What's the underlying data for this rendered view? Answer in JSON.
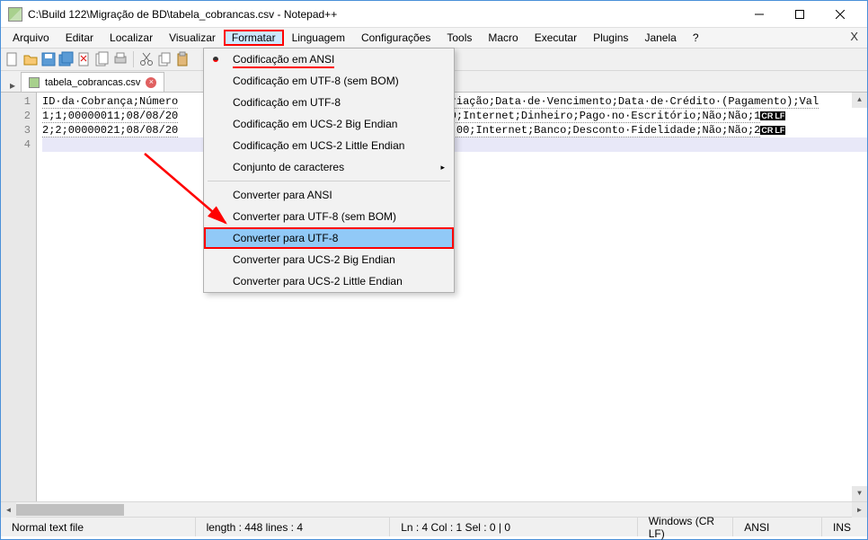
{
  "title": "C:\\Build 122\\Migração de BD\\tabela_cobrancas.csv - Notepad++",
  "menubar": [
    "Arquivo",
    "Editar",
    "Localizar",
    "Visualizar",
    "Formatar",
    "Linguagem",
    "Configurações",
    "Tools",
    "Macro",
    "Executar",
    "Plugins",
    "Janela",
    "?"
  ],
  "active_menu_index": 4,
  "tab": {
    "label": "tabela_cobrancas.csv"
  },
  "editor": {
    "line_numbers": [
      "1",
      "2",
      "3",
      "4"
    ],
    "lines": [
      {
        "prefix": "ID·da·Cobrança;Número",
        "suffix": "riação;Data·de·Vencimento;Data·de·Crédito·(Pagamento);Val",
        "crlf": false
      },
      {
        "prefix": "1;1;00000011;08/08/20",
        "suffix": "0;Internet;Dinheiro;Pago·no·Escritório;Não;Não;1",
        "crlf": true
      },
      {
        "prefix": "2;2;00000021;08/08/20",
        "suffix": ".00;Internet;Banco;Desconto·Fidelidade;Não;Não;2",
        "crlf": true
      },
      {
        "prefix": "",
        "suffix": "",
        "crlf": false
      }
    ]
  },
  "dropdown": {
    "items": [
      {
        "label": "Codificação em ANSI",
        "bullet": true,
        "underline": true
      },
      {
        "label": "Codificação em UTF-8 (sem BOM)"
      },
      {
        "label": "Codificação em UTF-8"
      },
      {
        "label": "Codificação em UCS-2 Big Endian"
      },
      {
        "label": "Codificação em UCS-2 Little Endian"
      },
      {
        "label": "Conjunto de caracteres",
        "submenu": true
      },
      {
        "separator": true
      },
      {
        "label": "Converter para ANSI"
      },
      {
        "label": "Converter para UTF-8 (sem BOM)"
      },
      {
        "label": "Converter para UTF-8",
        "highlighted": true,
        "redbox": true
      },
      {
        "label": "Converter para UCS-2 Big Endian"
      },
      {
        "label": "Converter para UCS-2 Little Endian"
      }
    ]
  },
  "status": {
    "type": "Normal text file",
    "length": "length : 448    lines : 4",
    "pos": "Ln : 4    Col : 1    Sel : 0 | 0",
    "eol": "Windows (CR LF)",
    "enc": "ANSI",
    "ins": "INS"
  }
}
